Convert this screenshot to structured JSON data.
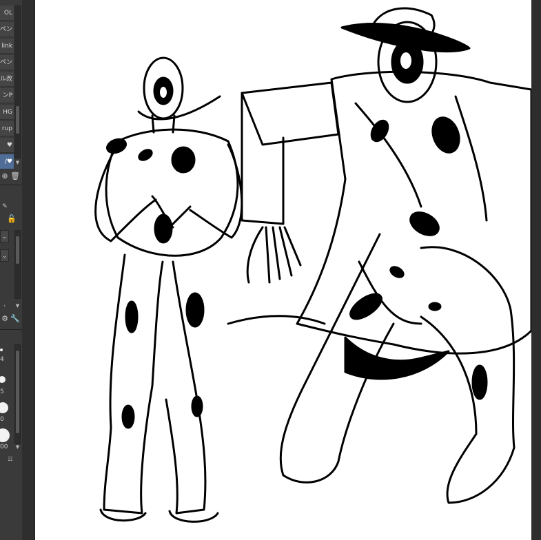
{
  "sub_tools": [
    {
      "label": "OL"
    },
    {
      "label": "ペン"
    },
    {
      "label": "link"
    },
    {
      "label": "ペン"
    },
    {
      "label": "ル改"
    },
    {
      "label": "ンP"
    },
    {
      "label": "HG"
    },
    {
      "label": "rup"
    },
    {
      "label": "♥"
    },
    {
      "label": "/♥"
    }
  ],
  "selected_sub_tool": "/♥",
  "brush_sizes": [
    "4",
    "5",
    "0",
    "00"
  ],
  "icons": {
    "add": "add-icon",
    "delete": "trash-icon",
    "lock": "lock-icon",
    "settings": "settings-icon",
    "wrench": "wrench-icon"
  },
  "colors": {
    "panel_bg": "#3a3a3a",
    "selected": "#4f6d96",
    "canvas": "#ffffff"
  }
}
